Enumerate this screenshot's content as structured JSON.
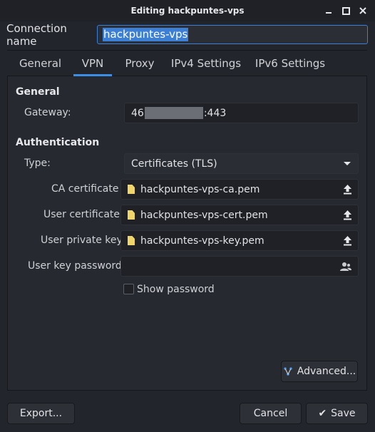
{
  "window": {
    "title": "Editing hackpuntes-vps"
  },
  "connection": {
    "label": "Connection name",
    "value": "hackpuntes-vps"
  },
  "tabs": [
    {
      "label": "General"
    },
    {
      "label": "VPN",
      "active": true
    },
    {
      "label": "Proxy"
    },
    {
      "label": "IPv4 Settings"
    },
    {
      "label": "IPv6 Settings"
    }
  ],
  "general": {
    "heading": "General",
    "gateway_label": "Gateway:",
    "gateway_prefix": "46",
    "gateway_suffix": ":443"
  },
  "auth": {
    "heading": "Authentication",
    "type_label": "Type:",
    "type_value": "Certificates (TLS)",
    "ca_label": "CA certificate",
    "ca_file": "hackpuntes-vps-ca.pem",
    "user_cert_label": "User certificate",
    "user_cert_file": "hackpuntes-vps-cert.pem",
    "user_key_label": "User private key",
    "user_key_file": "hackpuntes-vps-key.pem",
    "key_pw_label": "User key password",
    "key_pw_value": "",
    "show_password_label": "Show password",
    "show_password_checked": false
  },
  "buttons": {
    "advanced": "Advanced...",
    "export": "Export...",
    "cancel": "Cancel",
    "save": "Save"
  },
  "colors": {
    "accent": "#3c8ee6",
    "file_icon": "#f0d56a"
  }
}
